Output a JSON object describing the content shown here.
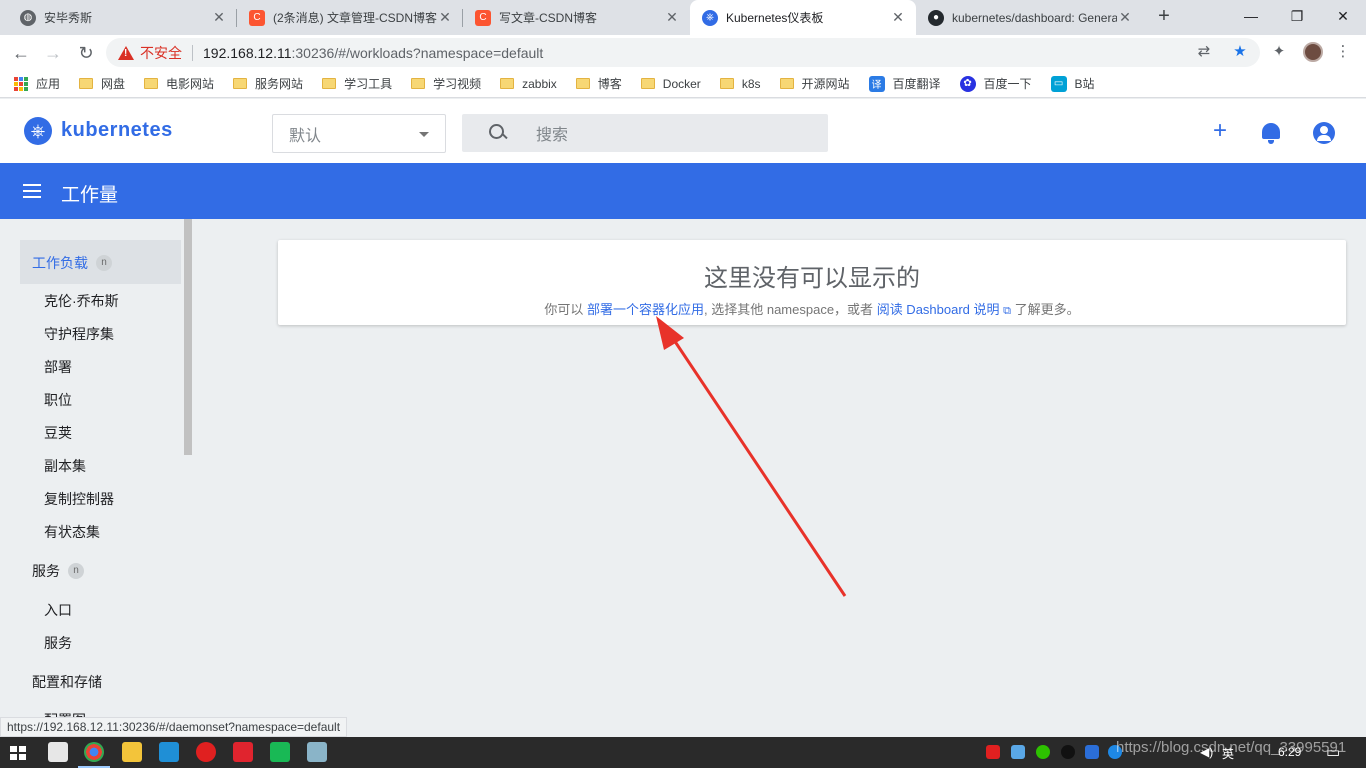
{
  "browser": {
    "tabs": [
      {
        "title": "安毕秀斯",
        "active": false
      },
      {
        "title": "(2条消息) 文章管理-CSDN博客",
        "active": false
      },
      {
        "title": "写文章-CSDN博客",
        "active": false
      },
      {
        "title": "Kubernetes仪表板",
        "active": true
      },
      {
        "title": "kubernetes/dashboard: General",
        "active": false
      }
    ],
    "security_label": "不安全",
    "url_host": "192.168.12.11",
    "url_rest": ":30236/#/workloads?namespace=default",
    "bookmarks": [
      "应用",
      "网盘",
      "电影网站",
      "服务网站",
      "学习工具",
      "学习视频",
      "zabbix",
      "博客",
      "Docker",
      "k8s",
      "开源网站",
      "百度翻译",
      "百度一下",
      "B站"
    ]
  },
  "app": {
    "name": "kubernetes",
    "namespace_selected": "默认",
    "search_placeholder": "搜索",
    "page_title": "工作量"
  },
  "sidebar": {
    "sections": [
      {
        "title": "工作负载",
        "active": true,
        "items": [
          "克伦·乔布斯",
          "守护程序集",
          "部署",
          "职位",
          "豆荚",
          "副本集",
          "复制控制器",
          "有状态集"
        ]
      },
      {
        "title": "服务",
        "items": [
          "入口",
          "服务"
        ]
      },
      {
        "title": "配置和存储",
        "items": [
          "配置图"
        ]
      }
    ],
    "info_glyph": "n"
  },
  "empty_state": {
    "heading": "这里没有可以显示的",
    "text_prefix": "你可以",
    "deploy_link": "部署一个容器化应用",
    "text_middle": ", 选择其他 namespace，或者",
    "docs_link": "阅读 Dashboard 说明",
    "text_suffix": "了解更多。"
  },
  "status_url": "https://192.168.12.11:30236/#/daemonset?namespace=default",
  "taskbar": {
    "ime_label": "英",
    "clock": "6:29",
    "watermark": "https://blog.csdn.net/qq_33995591"
  },
  "colors": {
    "brand": "#326ce5",
    "annotation_arrow": "#e8322a",
    "insecure": "#d93025"
  }
}
